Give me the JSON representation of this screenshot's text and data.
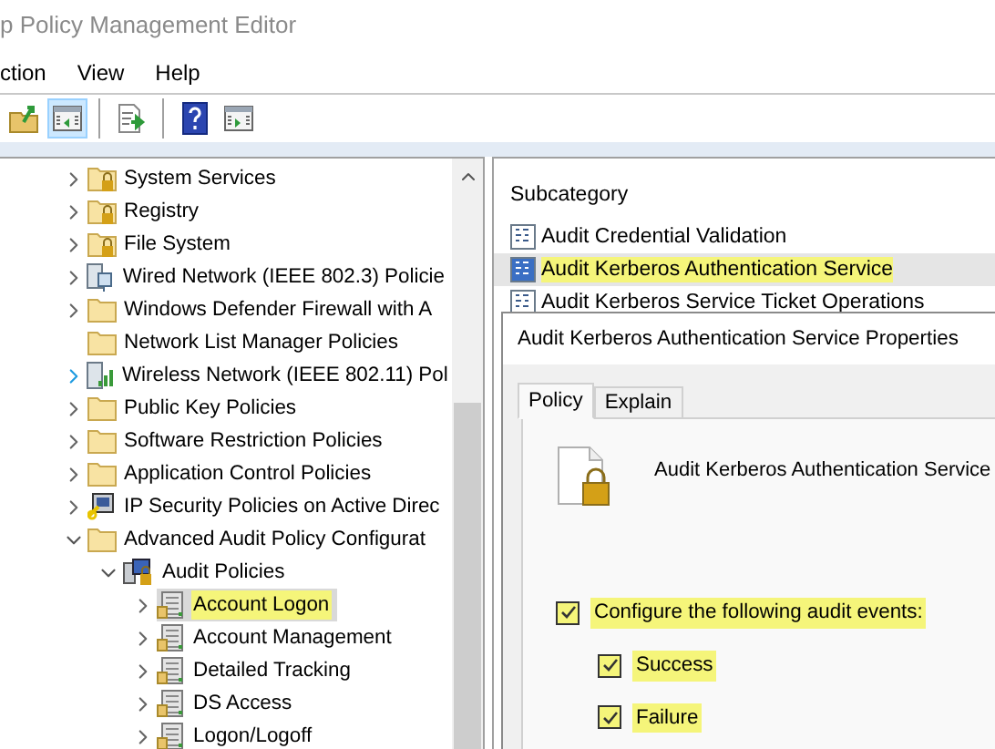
{
  "window": {
    "title": "p Policy Management Editor"
  },
  "menu": [
    "ction",
    "View",
    "Help"
  ],
  "toolbar": [
    {
      "kind": "up",
      "selected": false
    },
    {
      "kind": "pane",
      "selected": true
    },
    {
      "kind": "separator"
    },
    {
      "kind": "export",
      "selected": false
    },
    {
      "kind": "separator"
    },
    {
      "kind": "help",
      "selected": false
    },
    {
      "kind": "pane-alt",
      "selected": false
    }
  ],
  "tree": [
    {
      "label": "System Services",
      "kind": "locked-folder",
      "expandable": true,
      "expanded": false,
      "hovered": false,
      "selected": false,
      "highlighted": false
    },
    {
      "label": "Registry",
      "kind": "locked-folder",
      "expandable": true,
      "expanded": false,
      "hovered": false,
      "selected": false,
      "highlighted": false
    },
    {
      "label": "File System",
      "kind": "locked-folder",
      "expandable": true,
      "expanded": false,
      "hovered": false,
      "selected": false,
      "highlighted": false
    },
    {
      "label": "Wired Network (IEEE 802.3) Policie",
      "kind": "network",
      "expandable": true,
      "expanded": false,
      "hovered": false,
      "selected": false,
      "highlighted": false
    },
    {
      "label": "Windows Defender Firewall with A",
      "kind": "folder",
      "expandable": true,
      "expanded": false,
      "hovered": false,
      "selected": false,
      "highlighted": false
    },
    {
      "label": "Network List Manager Policies",
      "kind": "folder",
      "expandable": false,
      "selected": false,
      "highlighted": false
    },
    {
      "label": "Wireless Network (IEEE 802.11) Pol",
      "kind": "wireless",
      "expandable": true,
      "expanded": false,
      "hovered": true,
      "selected": false,
      "highlighted": false
    },
    {
      "label": "Public Key Policies",
      "kind": "folder",
      "expandable": true,
      "expanded": false,
      "hovered": false,
      "selected": false,
      "highlighted": false
    },
    {
      "label": "Software Restriction Policies",
      "kind": "folder",
      "expandable": true,
      "expanded": false,
      "hovered": false,
      "selected": false,
      "highlighted": false
    },
    {
      "label": "Application Control Policies",
      "kind": "folder",
      "expandable": true,
      "expanded": false,
      "hovered": false,
      "selected": false,
      "highlighted": false
    },
    {
      "label": "IP Security Policies on Active Direc",
      "kind": "ipsec",
      "expandable": true,
      "expanded": false,
      "hovered": false,
      "selected": false,
      "highlighted": false
    },
    {
      "label": "Advanced Audit Policy Configurat",
      "kind": "folder",
      "expandable": true,
      "expanded": true,
      "hovered": false,
      "selected": false,
      "highlighted": false,
      "children": [
        {
          "label": "Audit Policies",
          "kind": "audit",
          "expandable": true,
          "expanded": true,
          "hovered": false,
          "selected": false,
          "highlighted": false,
          "children": [
            {
              "label": "Account Logon",
              "kind": "category",
              "expandable": true,
              "expanded": false,
              "hovered": false,
              "selected": true,
              "highlighted": true
            },
            {
              "label": "Account Management",
              "kind": "category",
              "expandable": true,
              "expanded": false,
              "hovered": false,
              "selected": false,
              "highlighted": false
            },
            {
              "label": "Detailed Tracking",
              "kind": "category",
              "expandable": true,
              "expanded": false,
              "hovered": false,
              "selected": false,
              "highlighted": false
            },
            {
              "label": "DS Access",
              "kind": "category",
              "expandable": true,
              "expanded": false,
              "hovered": false,
              "selected": false,
              "highlighted": false
            },
            {
              "label": "Logon/Logoff",
              "kind": "category",
              "expandable": true,
              "expanded": false,
              "hovered": false,
              "selected": false,
              "highlighted": false
            }
          ]
        }
      ]
    }
  ],
  "subcategory": {
    "header": "Subcategory",
    "rows": [
      {
        "label": "Audit Credential Validation",
        "selected": false,
        "highlighted": false
      },
      {
        "label": "Audit Kerberos Authentication Service",
        "selected": true,
        "highlighted": true
      },
      {
        "label": "Audit Kerberos Service Ticket Operations",
        "selected": false,
        "highlighted": false
      }
    ]
  },
  "dialog": {
    "title": "Audit Kerberos Authentication Service Properties",
    "tabs": [
      {
        "label": "Policy",
        "selected": true
      },
      {
        "label": "Explain",
        "selected": false
      }
    ],
    "policy_name": "Audit Kerberos Authentication Service",
    "options": [
      {
        "label": "Configure the following audit events:",
        "checked": true,
        "highlighted": true,
        "children": [
          {
            "label": "Success",
            "checked": true,
            "highlighted": true
          },
          {
            "label": "Failure",
            "checked": true,
            "highlighted": true
          }
        ]
      }
    ]
  }
}
